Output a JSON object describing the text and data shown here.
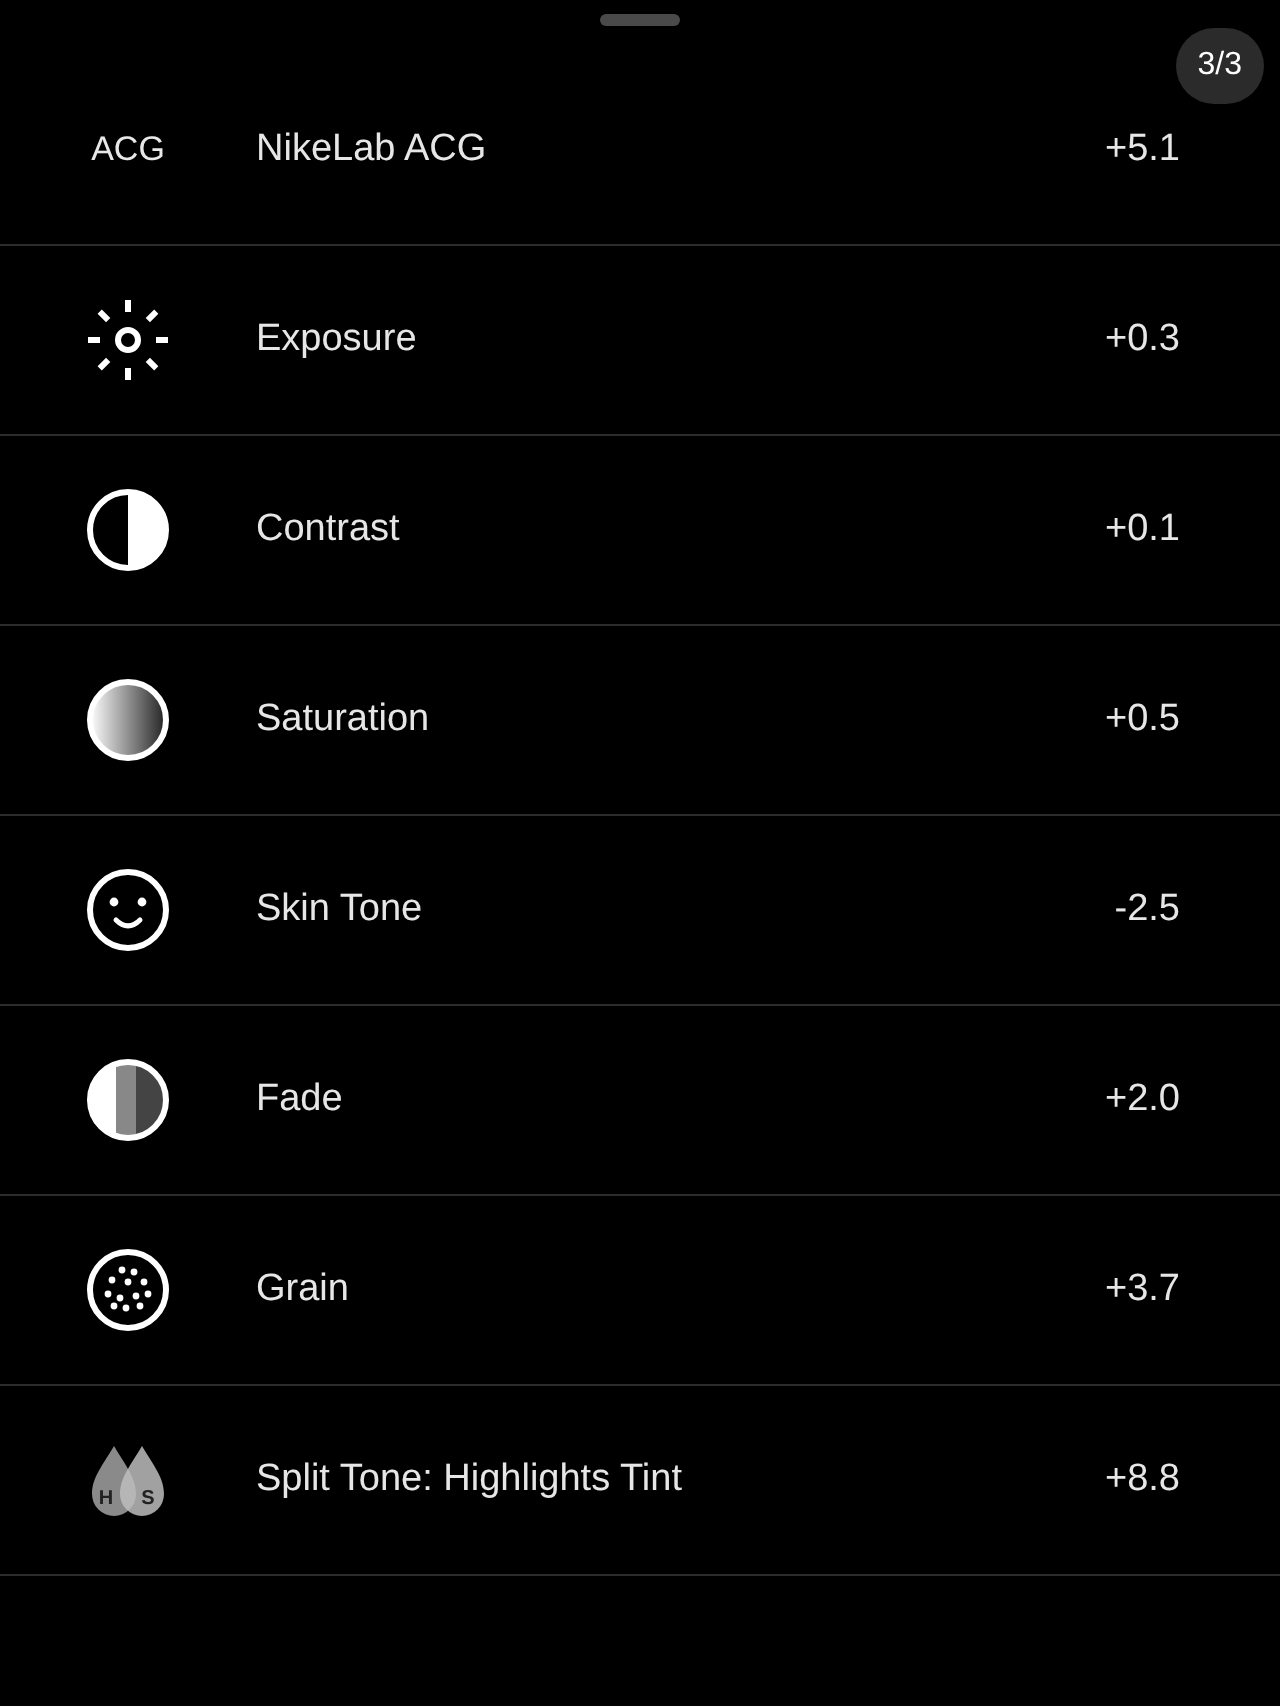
{
  "page_badge": "3/3",
  "adjustments": [
    {
      "icon": {
        "kind": "label",
        "text": "ACG"
      },
      "name": "NikeLab ACG",
      "value": "+5.1"
    },
    {
      "icon": {
        "kind": "exposure"
      },
      "name": "Exposure",
      "value": "+0.3"
    },
    {
      "icon": {
        "kind": "contrast"
      },
      "name": "Contrast",
      "value": "+0.1"
    },
    {
      "icon": {
        "kind": "saturation"
      },
      "name": "Saturation",
      "value": "+0.5"
    },
    {
      "icon": {
        "kind": "skin"
      },
      "name": "Skin Tone",
      "value": "-2.5"
    },
    {
      "icon": {
        "kind": "fade"
      },
      "name": "Fade",
      "value": "+2.0"
    },
    {
      "icon": {
        "kind": "grain"
      },
      "name": "Grain",
      "value": "+3.7"
    },
    {
      "icon": {
        "kind": "split",
        "letters": [
          "H",
          "S"
        ]
      },
      "name": "Split Tone: Highlights Tint",
      "value": "+8.8"
    }
  ]
}
